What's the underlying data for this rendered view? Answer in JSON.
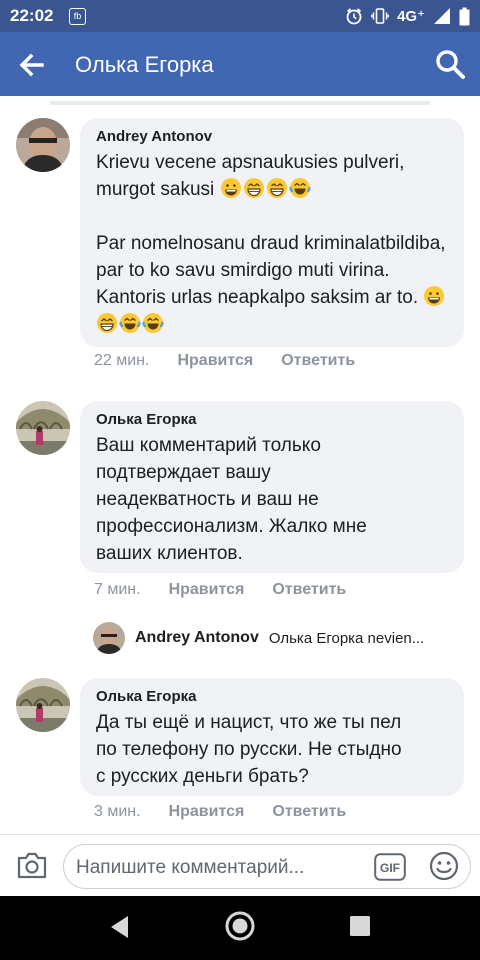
{
  "status_bar": {
    "time": "22:02",
    "app_badge": "fb",
    "network": "4G⁺"
  },
  "header": {
    "title": "Олька Егорка"
  },
  "comments": [
    {
      "author": "Andrey Antonov",
      "paragraphs": [
        "Krievu vecene apsnaukusies pulveri, murgot sakusi",
        "Par nomelnosanu draud kriminalatbildiba, par to ko savu smirdigo muti virina.  Kantoris urlas neapkalpo saksim ar to."
      ],
      "emojis": [
        "grinning-sweat",
        "beaming",
        "beaming",
        "joy"
      ],
      "emojis2": [
        "grinning-sweat",
        "beaming",
        "joy",
        "joy"
      ],
      "time": "22 мин.",
      "like": "Нравится",
      "reply": "Ответить"
    },
    {
      "author": "Олька Егорка",
      "lines": [
        "Ваш комментарий только",
        "подтверждает вашу",
        "неадекватность и ваш не",
        "профессионализм. Жалко мне",
        "ваших клиентов."
      ],
      "time": "7 мин.",
      "like": "Нравится",
      "reply": "Ответить"
    },
    {
      "author": "Олька Егорка",
      "lines": [
        "Да ты ещё и нацист, что же ты пел",
        "по телефону по русски. Не стыдно",
        "с русских деньги брать?"
      ],
      "time": "3 мин.",
      "like": "Нравится",
      "reply": "Ответить"
    }
  ],
  "reply_preview": {
    "author": "Andrey Antonov",
    "text": "Олька Егорка nevien..."
  },
  "comment_bar": {
    "placeholder": "Напишите комментарий...",
    "gif_label": "GIF"
  }
}
